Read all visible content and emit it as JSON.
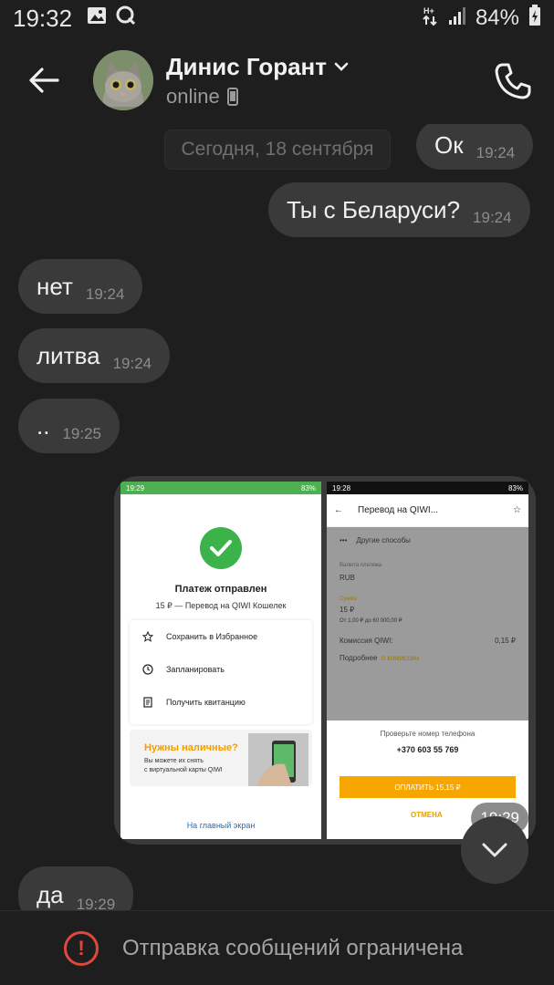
{
  "status_bar": {
    "time": "19:32",
    "battery": "84%"
  },
  "header": {
    "contact_name": "Динис Горант",
    "status": "online"
  },
  "chat": {
    "date_label": "Сегодня, 18 сентября",
    "messages": [
      {
        "text": "Ок",
        "time": "19:24",
        "side": "out"
      },
      {
        "text": "Ты с Беларуси?",
        "time": "19:24",
        "side": "out"
      },
      {
        "text": "нет",
        "time": "19:24",
        "side": "in"
      },
      {
        "text": "литва",
        "time": "19:24",
        "side": "in"
      },
      {
        "text": "..",
        "time": "19:25",
        "side": "in"
      },
      {
        "text": "да",
        "time": "19:29",
        "side": "in"
      }
    ],
    "image_message": {
      "time": "19:29",
      "left_screen": {
        "status_time": "19:29",
        "battery": "83%",
        "title": "Платеж отправлен",
        "subtitle": "15 ₽ — Перевод на QIWI Кошелек",
        "actions": [
          "Сохранить в Избранное",
          "Запланировать",
          "Получить квитанцию"
        ],
        "promo_title": "Нужны наличные?",
        "promo_text_1": "Вы можете их снять",
        "promo_text_2": "с виртуальной карты QIWI",
        "home_link": "На главный экран"
      },
      "right_screen": {
        "status_time": "19:28",
        "battery": "83%",
        "title": "Перевод на QIWI...",
        "other_methods": "Другие способы",
        "currency_label": "Валюта платежа",
        "currency": "RUB",
        "amount_label": "Сумма",
        "amount": "15 ₽",
        "amount_hint": "От 1,00 ₽ до 60 000,00 ₽",
        "fee_label": "Комиссия QIWI:",
        "fee": "0,15 ₽",
        "more": "Подробнее",
        "more_link": "о комиссии",
        "check_phone": "Проверьте номер телефона",
        "phone": "+370 603 55 769",
        "pay_button": "ОПЛАТИТЬ 15,15 ₽",
        "cancel": "ОТМЕНА"
      }
    }
  },
  "bottom": {
    "notice": "Отправка сообщений ограничена"
  },
  "colors": {
    "background": "#1e1e1e",
    "bubble": "#3a3a3a",
    "warning": "#e0483d",
    "qiwi_orange": "#f7a600",
    "qiwi_green": "#3bb34a"
  }
}
